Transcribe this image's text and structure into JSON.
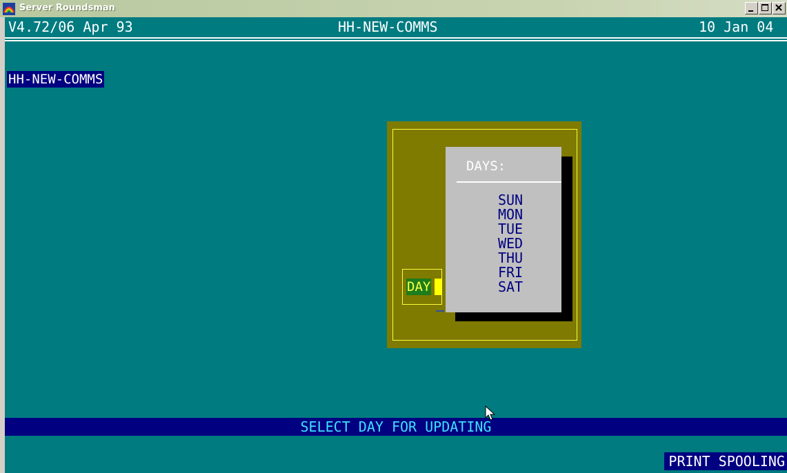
{
  "window": {
    "title": "Server Roundsman",
    "icon": "app-icon"
  },
  "header": {
    "version": "V4.72/06 Apr 93",
    "program": "HH-NEW-COMMS",
    "date": "10 Jan 04"
  },
  "screen_tag": "HH-NEW-COMMS",
  "field": {
    "label": "DAY"
  },
  "popup": {
    "title": "DAYS:",
    "options": [
      "SUN",
      "MON",
      "TUE",
      "WED",
      "THU",
      "FRI",
      "SAT"
    ]
  },
  "status": {
    "message": "SELECT DAY FOR UPDATING",
    "badge": "PRINT SPOOLING"
  },
  "colors": {
    "screen_bg": "#007b80",
    "panel_bg": "#7f7a00",
    "popup_bg": "#c0c0c0",
    "status_bg": "#000080",
    "status_text": "#40e0ff"
  }
}
